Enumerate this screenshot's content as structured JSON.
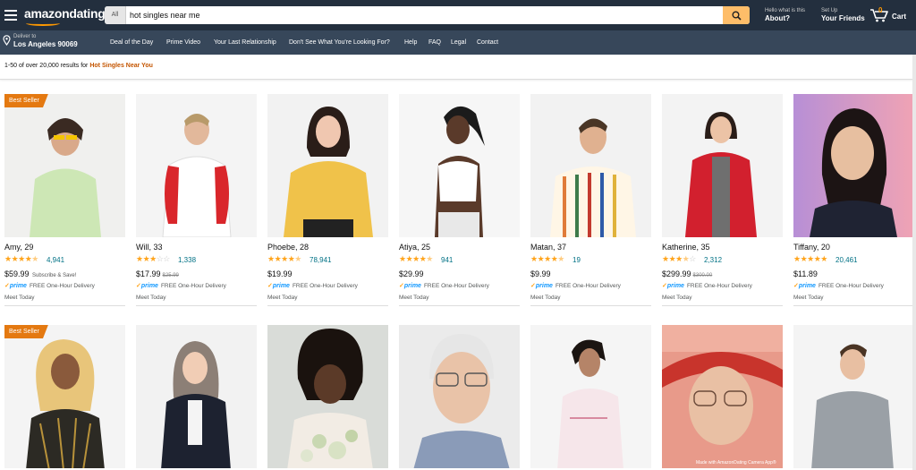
{
  "header": {
    "logo": "amazondating",
    "search_category": "All",
    "search_value": "hot singles near me",
    "about_small": "Hello what is this",
    "about_big": "About?",
    "friends_small": "Set Up",
    "friends_big": "Your Friends",
    "cart_count": "0",
    "cart_label": "Cart",
    "accent_color": "#febd69",
    "bar_color": "#232f3e"
  },
  "deliver": {
    "line1": "Deliver to",
    "line2": "Los Angeles 90069"
  },
  "nav": {
    "items": [
      "Deal of the Day",
      "Prime Video",
      "Your Last Relationship",
      "Don't See What You're Looking For?",
      "Help",
      "FAQ",
      "Legal",
      "Contact"
    ]
  },
  "results": {
    "prefix": "1-50 of over 20,000 results for ",
    "query": "Hot Singles Near You"
  },
  "products": [
    {
      "name": "Amy, 29",
      "stars": 4.5,
      "reviews": "4,941",
      "price": "$59.99",
      "old_price": "",
      "subscribe": "Subscribe & Save!",
      "prime": "prime",
      "delivery": "FREE One-Hour Delivery",
      "meet": "Meet Today",
      "badge": "Best Seller"
    },
    {
      "name": "Will, 33",
      "stars": 3,
      "reviews": "1,338",
      "price": "$17.99",
      "old_price": "$25.99",
      "subscribe": "",
      "prime": "prime",
      "delivery": "FREE One-Hour Delivery",
      "meet": "Meet Today",
      "badge": ""
    },
    {
      "name": "Phoebe, 28",
      "stars": 4.5,
      "reviews": "78,941",
      "price": "$19.99",
      "old_price": "",
      "subscribe": "",
      "prime": "prime",
      "delivery": "FREE One-Hour Delivery",
      "meet": "Meet Today",
      "badge": ""
    },
    {
      "name": "Atiya, 25",
      "stars": 4.5,
      "reviews": "941",
      "price": "$29.99",
      "old_price": "",
      "subscribe": "",
      "prime": "prime",
      "delivery": "FREE One-Hour Delivery",
      "meet": "Meet Today",
      "badge": ""
    },
    {
      "name": "Matan, 37",
      "stars": 4.5,
      "reviews": "19",
      "price": "$9.99",
      "old_price": "",
      "subscribe": "",
      "prime": "prime",
      "delivery": "FREE One-Hour Delivery",
      "meet": "Meet Today",
      "badge": ""
    },
    {
      "name": "Katherine, 35",
      "stars": 3.5,
      "reviews": "2,312",
      "price": "$299.99",
      "old_price": "$300.00",
      "subscribe": "",
      "prime": "prime",
      "delivery": "FREE One-Hour Delivery",
      "meet": "Meet Today",
      "badge": ""
    },
    {
      "name": "Tiffany, 20",
      "stars": 5,
      "reviews": "20,461",
      "price": "$11.89",
      "old_price": "",
      "subscribe": "",
      "prime": "prime",
      "delivery": "FREE One-Hour Delivery",
      "meet": "Meet Today",
      "badge": ""
    }
  ],
  "row2": [
    {
      "badge": "Best Seller",
      "caption": ""
    },
    {
      "badge": "",
      "caption": ""
    },
    {
      "badge": "",
      "caption": ""
    },
    {
      "badge": "",
      "caption": ""
    },
    {
      "badge": "",
      "caption": ""
    },
    {
      "badge": "",
      "caption": "Made with AmazonDating Camera App®"
    },
    {
      "badge": "",
      "caption": ""
    }
  ]
}
